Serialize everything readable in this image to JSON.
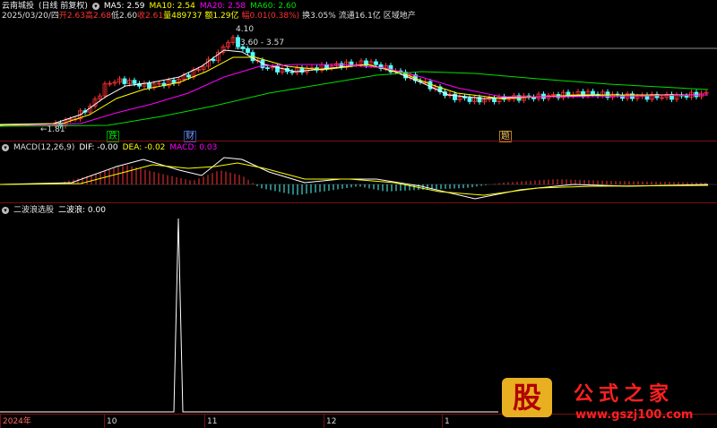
{
  "header": {
    "stock_name": "云南城投",
    "period": "(日线 前复权)",
    "ma5": "MA5: 2.59",
    "ma10": "MA10: 2.54",
    "ma20": "MA20: 2.58",
    "ma60": "MA60: 2.60",
    "info": {
      "date": "2025/03/20/四",
      "open": "开2.63",
      "high": "高2.68",
      "low": "低2.60",
      "close": "收2.61",
      "volume": "量489737",
      "amount": "额1.29亿",
      "change": "幅0.01(0.38%)",
      "turnover": "换3.05%",
      "float_cap": "流通16.1亿",
      "sector": "区域地产"
    }
  },
  "price_panel": {
    "high_label": "4.10",
    "range_label": "3.60 - 3.57",
    "low_label": "1.81",
    "markers": [
      "跌",
      "财",
      "题"
    ]
  },
  "macd_panel": {
    "title": "MACD(12,26,9)",
    "dif": "DIF: -0.00",
    "dea": "DEA: -0.02",
    "macd": "MACD: 0.03"
  },
  "indicator_panel": {
    "title": "二波浪选股",
    "value": "二波浪: 0.00"
  },
  "time_axis": [
    "2024年",
    "10",
    "11",
    "12",
    "1"
  ],
  "watermark": {
    "logo_text": "股",
    "brand": "公式之家",
    "url": "www.gszj100.com"
  },
  "colors": {
    "up": "#ff3232",
    "down": "#54ffff",
    "ma5": "#ffffff",
    "ma10": "#ffff00",
    "ma20": "#ff00ff",
    "ma60": "#00e000",
    "grid": "#7a1010",
    "brand": "#ff2020"
  }
}
